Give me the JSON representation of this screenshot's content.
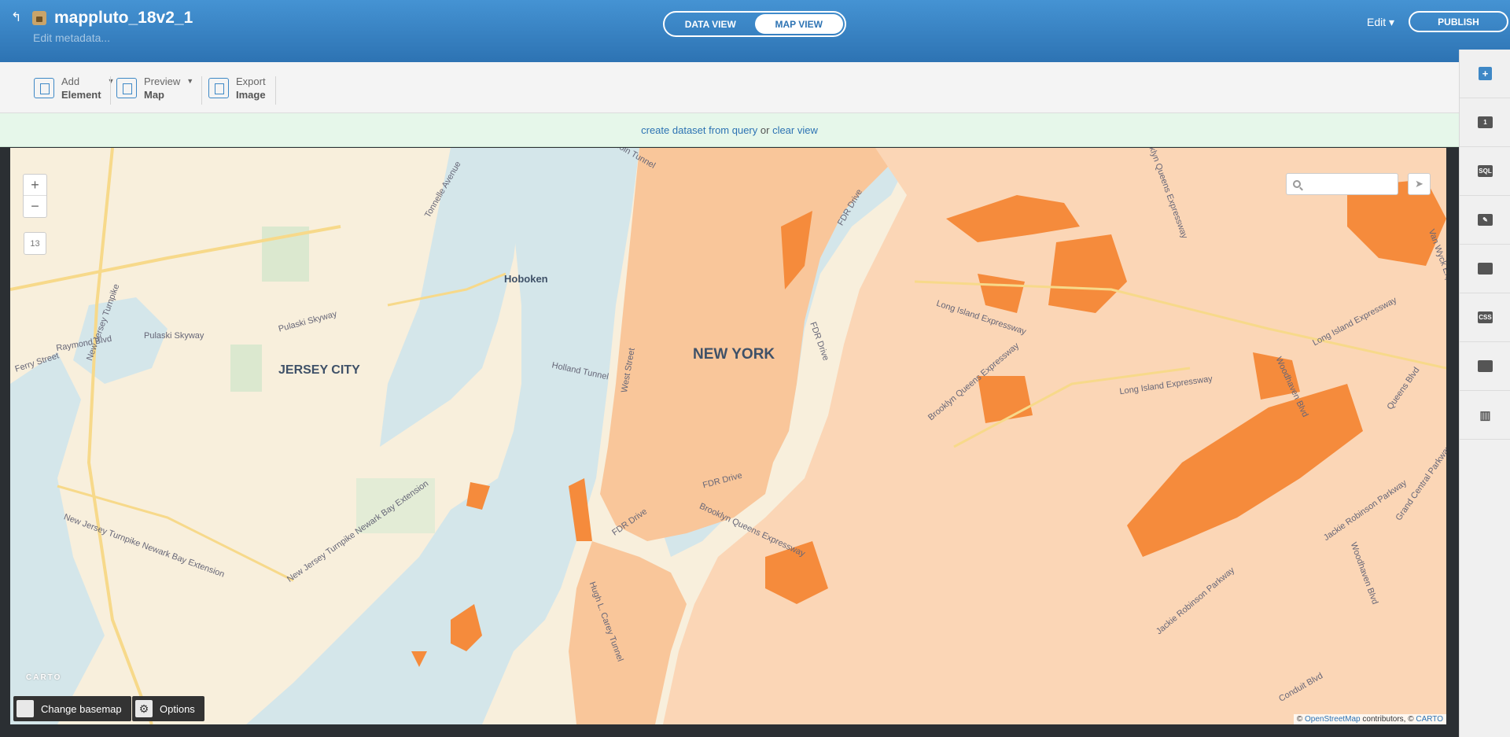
{
  "header": {
    "title": "mappluto_18v2_1",
    "subtitle": "Edit metadata...",
    "view_toggle": [
      "DATA VIEW",
      "MAP VIEW"
    ],
    "active_view": "MAP VIEW",
    "edit_label": "Edit ▾",
    "publish_label": "PUBLISH"
  },
  "toolbar": {
    "add": {
      "line1": "Add",
      "line2": "Element"
    },
    "preview": {
      "line1": "Preview",
      "line2": "Map"
    },
    "export": {
      "line1": "Export",
      "line2": "Image"
    }
  },
  "notice": {
    "link1": "create dataset from query",
    "or": " or ",
    "link2": "clear view"
  },
  "map": {
    "zoom_in": "+",
    "zoom_out": "−",
    "zoom_level": "13",
    "search_placeholder": "",
    "cities": {
      "new_york": "NEW YORK",
      "jersey_city": "JERSEY CITY",
      "hoboken": "Hoboken"
    },
    "roads": {
      "nj_turnpike": "New Jersey Turnpike",
      "pulaski_skyway": "Pulaski Skyway",
      "pulaski_skyway2": "Pulaski Skyway",
      "raymond_blvd": "Raymond Blvd",
      "ferry_street": "Ferry Street",
      "holland_tunnel": "Holland Tunnel",
      "lincoln_tunnel": "Lincoln Tunnel",
      "tonnelle_ave": "Tonnelle Avenue",
      "nj_turnpike_newark": "New Jersey Turnpike Newark Bay Extension",
      "nj_turnpike_newark2": "New Jersey Turnpike Newark Bay Extension",
      "fdr_drive": "FDR Drive",
      "fdr_drive2": "FDR Drive",
      "fdr_drive3": "FDR Drive",
      "fdr_drive4": "FDR Drive",
      "west_street": "West Street",
      "bqe": "Brooklyn Queens Expressway",
      "bqe2": "Brooklyn Queens Expressway",
      "lie": "Long Island Expressway",
      "lie2": "Long Island Expressway",
      "lie3": "Long Island Expressway",
      "hugh_carey": "Hugh L. Carey Tunnel",
      "jackie_robinson": "Jackie Robinson Parkway",
      "jackie_robinson2": "Jackie Robinson Parkway",
      "woodhaven": "Woodhaven Blvd",
      "woodhaven2": "Woodhaven Blvd",
      "queens_blvd": "Queens Blvd",
      "van_wyck": "Van Wyck Expressway",
      "conduit": "Conduit Blvd",
      "bqe_north": "Brooklyn Queens Expressway",
      "grand_central": "Grand Central Parkway"
    },
    "carto_logo": "CARTO",
    "change_basemap": "Change basemap",
    "options": "Options",
    "attribution_prefix": "© ",
    "attribution_osm": "OpenStreetMap",
    "attribution_mid": " contributors, © ",
    "attribution_carto": "CARTO"
  },
  "right_panel": {
    "add_layer": "+",
    "layer_number": "1",
    "sql": "SQL",
    "css": "CSS"
  },
  "colors": {
    "accent": "#2d73b3",
    "lots": "#f58b3c",
    "water": "#d4e6ea",
    "land": "#f8efdc"
  }
}
